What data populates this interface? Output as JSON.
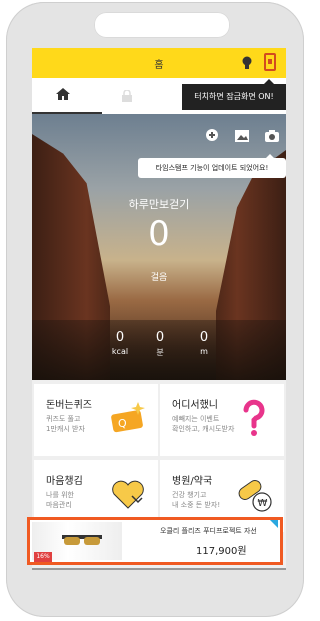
{
  "topbar": {
    "title": "홈"
  },
  "tooltip": {
    "text": "터치하면 잠금화면 ON!"
  },
  "hero": {
    "notice": "타임스탬프 기능이 업데이트 되었어요!",
    "walk_title": "하루만보걷기",
    "walk_count": "0",
    "walk_unit": "걸음",
    "stats": [
      {
        "value": "0",
        "unit": "kcal"
      },
      {
        "value": "0",
        "unit": "분"
      },
      {
        "value": "0",
        "unit": "m"
      }
    ]
  },
  "cards": [
    {
      "title": "돈버는퀴즈",
      "sub1": "퀴즈도 풀고",
      "sub2": "1만캐시 받자"
    },
    {
      "title": "어디서했니",
      "sub1": "예빼지는 이벤트",
      "sub2": "확인하고, 캐시도받자"
    },
    {
      "title": "마음챙김",
      "sub1": "나를 위한",
      "sub2": "마음관리"
    },
    {
      "title": "병원/약국",
      "sub1": "건강 챙기고",
      "sub2": "내 소중 돈 받자!"
    }
  ],
  "ad": {
    "name": "오클리 플리즈 푸디프로젝트 자선",
    "price": "117,900원",
    "sale": "16%"
  },
  "colors": {
    "topbar": "#ffd91a",
    "ad_border": "#f05a22"
  }
}
